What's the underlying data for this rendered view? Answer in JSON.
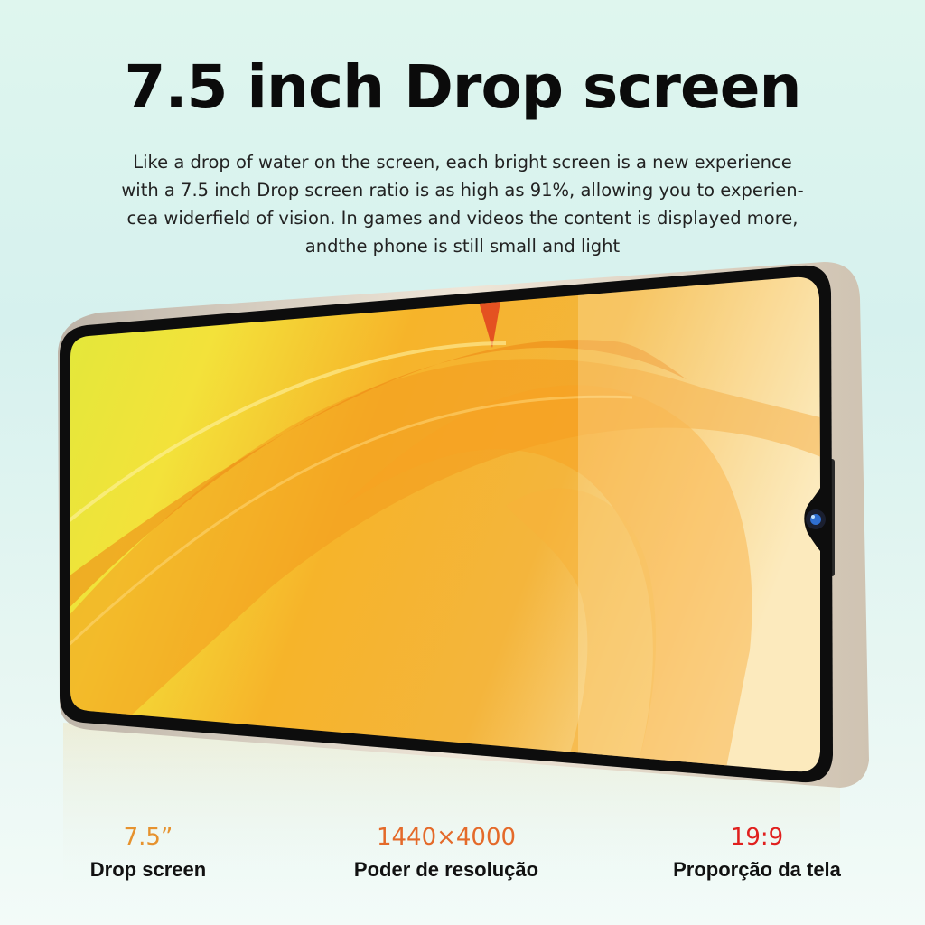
{
  "headline": "7.5 inch Drop screen",
  "description": [
    "Like a drop of water on the screen, each  bright screen is a new experience",
    "with  a 7.5 inch Drop screen  ratio is as high as 91%, allowing you to experien-",
    "cea widerfield of vision. In games and videos the content is displayed more,",
    "andthe phone is still small and light"
  ],
  "specs": [
    {
      "value": "7.5”",
      "label": "Drop screen",
      "color": "#e6922e"
    },
    {
      "value": "1440×4000",
      "label": "Poder de resolução",
      "color": "#e46a2a"
    },
    {
      "value": "19:9",
      "label": "Proporção da tela",
      "color": "#e0201e"
    }
  ],
  "colors": {
    "background": "#dff6ee",
    "screen_warm": "#f2a81f",
    "screen_yellow": "#f1ea3a",
    "frame": "#e7ddcf",
    "bezel": "#111111"
  }
}
